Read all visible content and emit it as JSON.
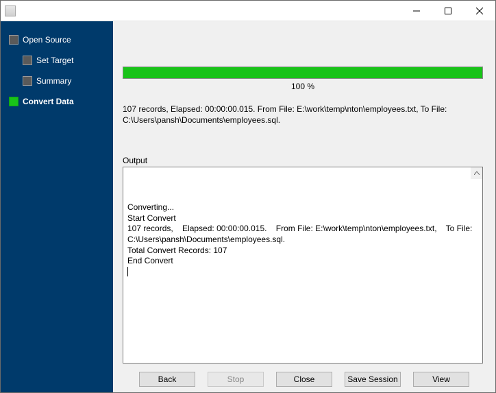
{
  "titlebar": {
    "title": ""
  },
  "sidebar": {
    "items": [
      {
        "label": "Open Source",
        "level": 0,
        "active": false
      },
      {
        "label": "Set Target",
        "level": 1,
        "active": false
      },
      {
        "label": "Summary",
        "level": 1,
        "active": false
      },
      {
        "label": "Convert Data",
        "level": 0,
        "active": true
      }
    ]
  },
  "progress": {
    "percent": 100,
    "percent_label": "100 %"
  },
  "status_text": "107 records,    Elapsed: 00:00:00.015.    From File: E:\\work\\temp\\nton\\employees.txt,    To File: C:\\Users\\pansh\\Documents\\employees.sql.",
  "output": {
    "label": "Output",
    "lines": [
      "Converting...",
      "Start Convert",
      "107 records,    Elapsed: 00:00:00.015.    From File: E:\\work\\temp\\nton\\employees.txt,    To File: C:\\Users\\pansh\\Documents\\employees.sql.",
      "Total Convert Records: 107",
      "End Convert"
    ]
  },
  "buttons": {
    "back": {
      "label": "Back",
      "enabled": true
    },
    "stop": {
      "label": "Stop",
      "enabled": false
    },
    "close": {
      "label": "Close",
      "enabled": true
    },
    "save": {
      "label": "Save Session",
      "enabled": true
    },
    "view": {
      "label": "View",
      "enabled": true
    }
  },
  "colors": {
    "sidebar_bg": "#003a6b",
    "progress_fill": "#19c319"
  }
}
